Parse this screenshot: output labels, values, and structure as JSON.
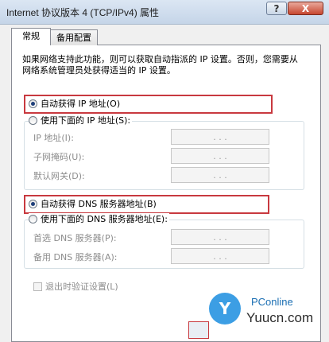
{
  "window": {
    "title": "Internet 协议版本 4 (TCP/IPv4) 属性",
    "help_label": "?",
    "close_label": "X"
  },
  "tabs": [
    {
      "label": "常规"
    },
    {
      "label": "备用配置"
    }
  ],
  "description": "如果网络支持此功能，则可以获取自动指派的 IP 设置。否则，您需要从网络系统管理员处获得适当的 IP 设置。",
  "ip_section": {
    "auto_label": "自动获得 IP 地址(O)",
    "manual_label": "使用下面的 IP 地址(S):",
    "auto_selected": true,
    "fields": [
      {
        "label": "IP 地址(I):",
        "value": ". . ."
      },
      {
        "label": "子网掩码(U):",
        "value": ". . ."
      },
      {
        "label": "默认网关(D):",
        "value": ". . ."
      }
    ]
  },
  "dns_section": {
    "auto_label": "自动获得 DNS 服务器地址(B)",
    "manual_label": "使用下面的 DNS 服务器地址(E):",
    "auto_selected": true,
    "fields": [
      {
        "label": "首选 DNS 服务器(P):",
        "value": ". . ."
      },
      {
        "label": "备用 DNS 服务器(A):",
        "value": ". . ."
      }
    ]
  },
  "validate_on_exit_label": "退出时验证设置(L)",
  "watermark": {
    "brand": "PConline",
    "site": "Yuucn.com"
  },
  "colors": {
    "highlight_border": "#c8393f",
    "watermark_blue": "#1b8ee0"
  }
}
